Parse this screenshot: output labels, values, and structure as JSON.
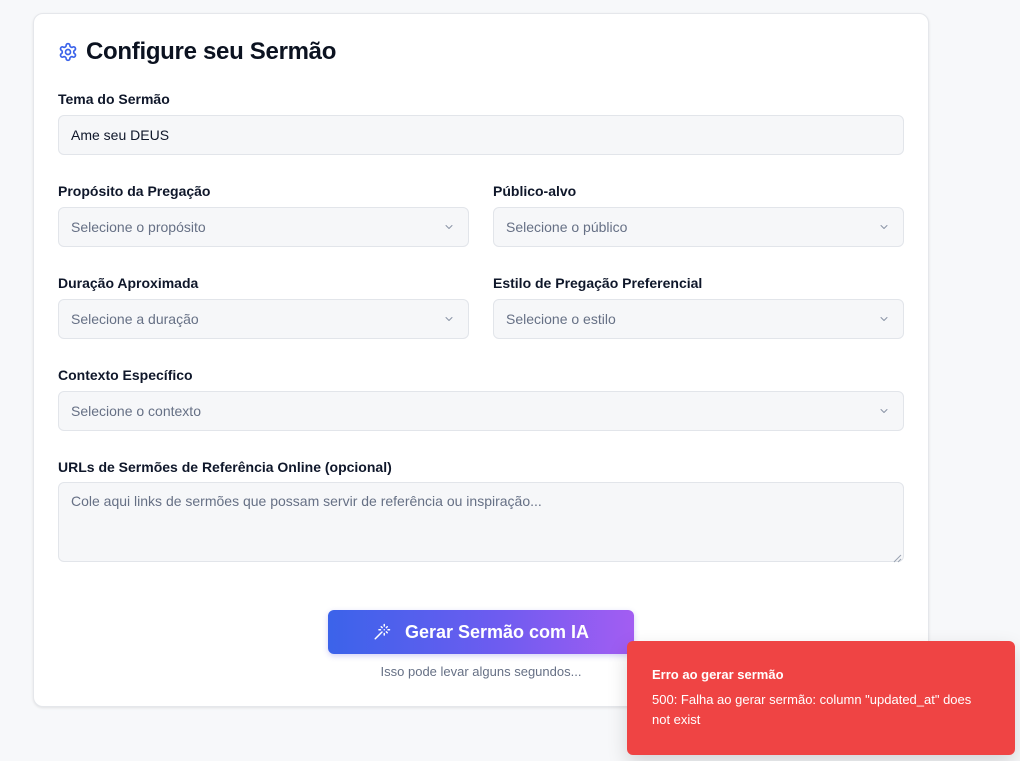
{
  "header": {
    "title": "Configure seu Sermão",
    "icon": "gear-icon"
  },
  "form": {
    "tema": {
      "label": "Tema do Sermão",
      "value": "Ame seu DEUS"
    },
    "proposito": {
      "label": "Propósito da Pregação",
      "placeholder": "Selecione o propósito"
    },
    "publico": {
      "label": "Público-alvo",
      "placeholder": "Selecione o público"
    },
    "duracao": {
      "label": "Duração Aproximada",
      "placeholder": "Selecione a duração"
    },
    "estilo": {
      "label": "Estilo de Pregação Preferencial",
      "placeholder": "Selecione o estilo"
    },
    "contexto": {
      "label": "Contexto Específico",
      "placeholder": "Selecione o contexto"
    },
    "urls": {
      "label": "URLs de Sermões de Referência Online (opcional)",
      "placeholder": "Cole aqui links de sermões que possam servir de referência ou inspiração..."
    }
  },
  "actions": {
    "generate_label": "Gerar Sermão com IA",
    "hint": "Isso pode levar alguns segundos..."
  },
  "toast": {
    "title": "Erro ao gerar sermão",
    "message": "500: Falha ao gerar sermão: column \"updated_at\" does not exist"
  },
  "colors": {
    "accent": "#3b63ea",
    "gradient_end": "#a35df2",
    "error": "#ef4444",
    "background": "#f7f8fa"
  }
}
